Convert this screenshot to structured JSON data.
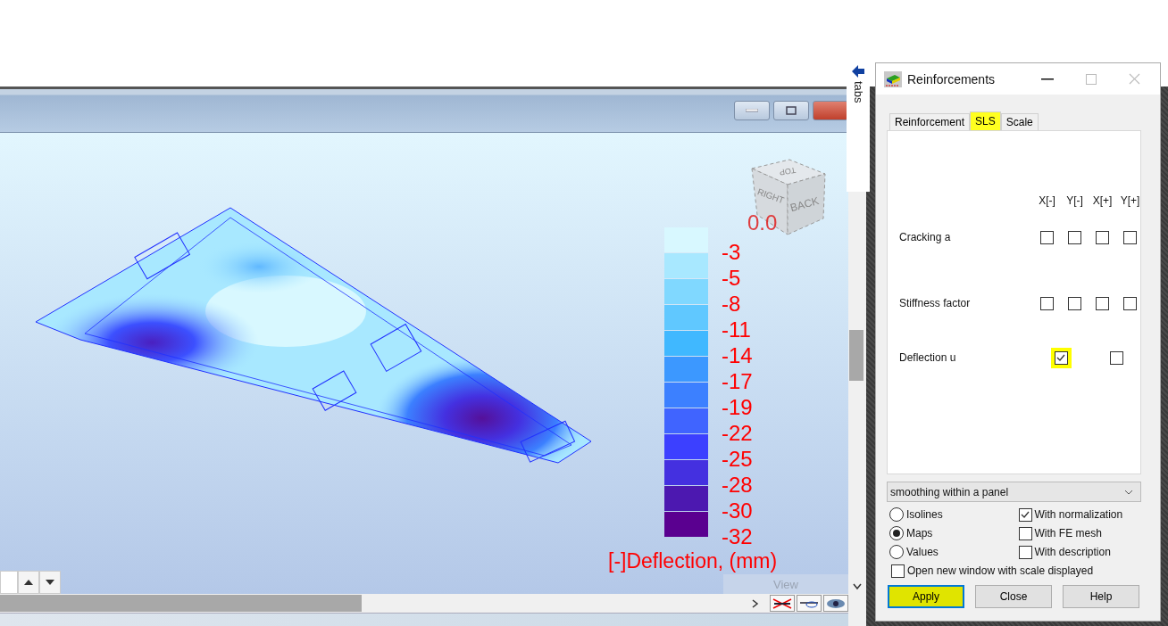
{
  "viewport": {
    "view_cube": {
      "faces": [
        "TOP",
        "RIGHT",
        "BACK"
      ]
    },
    "legend": {
      "top_label": "0.0",
      "title": "[-]Deflection, (mm)",
      "bands": [
        {
          "color": "#d8f8ff",
          "label": "-3"
        },
        {
          "color": "#a8e8ff",
          "label": "-5"
        },
        {
          "color": "#80d8ff",
          "label": "-8"
        },
        {
          "color": "#60c8ff",
          "label": "-11"
        },
        {
          "color": "#40b8ff",
          "label": "-14"
        },
        {
          "color": "#3c98ff",
          "label": "-17"
        },
        {
          "color": "#3c80ff",
          "label": "-19"
        },
        {
          "color": "#4064ff",
          "label": "-22"
        },
        {
          "color": "#3c40ff",
          "label": "-25"
        },
        {
          "color": "#4430e0",
          "label": "-28"
        },
        {
          "color": "#4c18b0",
          "label": "-30"
        },
        {
          "color": "#5a0090",
          "label": "-32"
        }
      ]
    },
    "view_label": "View"
  },
  "side_tab": {
    "label": "tabs"
  },
  "dialog": {
    "title": "Reinforcements",
    "tabs": [
      {
        "label": "Reinforcement",
        "selected": false,
        "highlighted": false
      },
      {
        "label": "SLS",
        "selected": true,
        "highlighted": true
      },
      {
        "label": "Scale",
        "selected": false,
        "highlighted": false
      }
    ],
    "columns": [
      "X[-]",
      "Y[-]",
      "X[+]",
      "Y[+]"
    ],
    "rows": [
      {
        "label": "Cracking a",
        "kind": "quad",
        "checks": [
          {
            "checked": false,
            "highlighted": false
          },
          {
            "checked": false,
            "highlighted": false
          },
          {
            "checked": false,
            "highlighted": false
          },
          {
            "checked": false,
            "highlighted": false
          }
        ]
      },
      {
        "label": "Stiffness factor",
        "kind": "quad",
        "checks": [
          {
            "checked": false,
            "highlighted": false
          },
          {
            "checked": false,
            "highlighted": false
          },
          {
            "checked": false,
            "highlighted": false
          },
          {
            "checked": false,
            "highlighted": false
          }
        ]
      },
      {
        "label": "Deflection u",
        "kind": "pair",
        "checks": [
          {
            "checked": true,
            "highlighted": true
          },
          {
            "checked": false,
            "highlighted": false
          }
        ]
      }
    ],
    "smoothing": {
      "value": "smoothing within a panel"
    },
    "display_modes": [
      {
        "label": "Isolines",
        "selected": false
      },
      {
        "label": "Maps",
        "selected": true
      },
      {
        "label": "Values",
        "selected": false
      }
    ],
    "options": [
      {
        "label": "With normalization",
        "checked": true
      },
      {
        "label": "With FE mesh",
        "checked": false
      },
      {
        "label": "With description",
        "checked": false
      }
    ],
    "open_new_window": {
      "label": "Open new window with scale displayed",
      "checked": false
    },
    "buttons": [
      {
        "label": "Apply",
        "highlighted": true,
        "is_default": true
      },
      {
        "label": "Close",
        "highlighted": false,
        "is_default": false
      },
      {
        "label": "Help",
        "highlighted": false,
        "is_default": false
      }
    ]
  }
}
